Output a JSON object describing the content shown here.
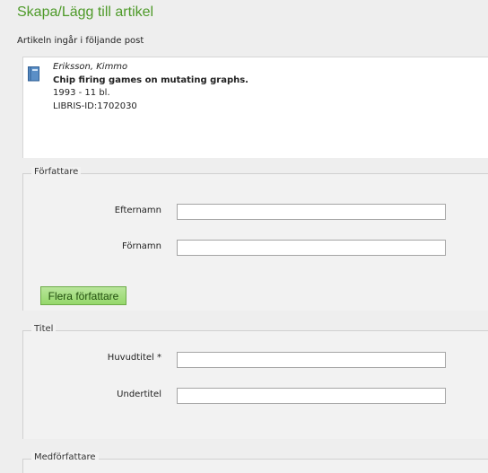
{
  "page": {
    "title": "Skapa/Lägg till artikel",
    "intro": "Artikeln ingår i följande post"
  },
  "record": {
    "icon": "book-icon",
    "author": "Eriksson, Kimmo",
    "title": "Chip firing games on mutating graphs.",
    "year_issue": "1993 - 11 bl.",
    "libris_id": "LIBRIS-ID:1702030"
  },
  "authors_panel": {
    "legend": "Författare",
    "lastname_label": "Efternamn",
    "lastname_value": "",
    "firstname_label": "Förnamn",
    "firstname_value": "",
    "more_authors_button": "Flera författare"
  },
  "title_panel": {
    "legend": "Titel",
    "main_title_label": "Huvudtitel *",
    "main_title_value": "",
    "subtitle_label": "Undertitel",
    "subtitle_value": ""
  },
  "coauthors_panel": {
    "legend": "Medförfattare"
  },
  "colors": {
    "accent": "#4e9a29",
    "button_fill": "#a6de82",
    "background": "#eeeeee"
  }
}
